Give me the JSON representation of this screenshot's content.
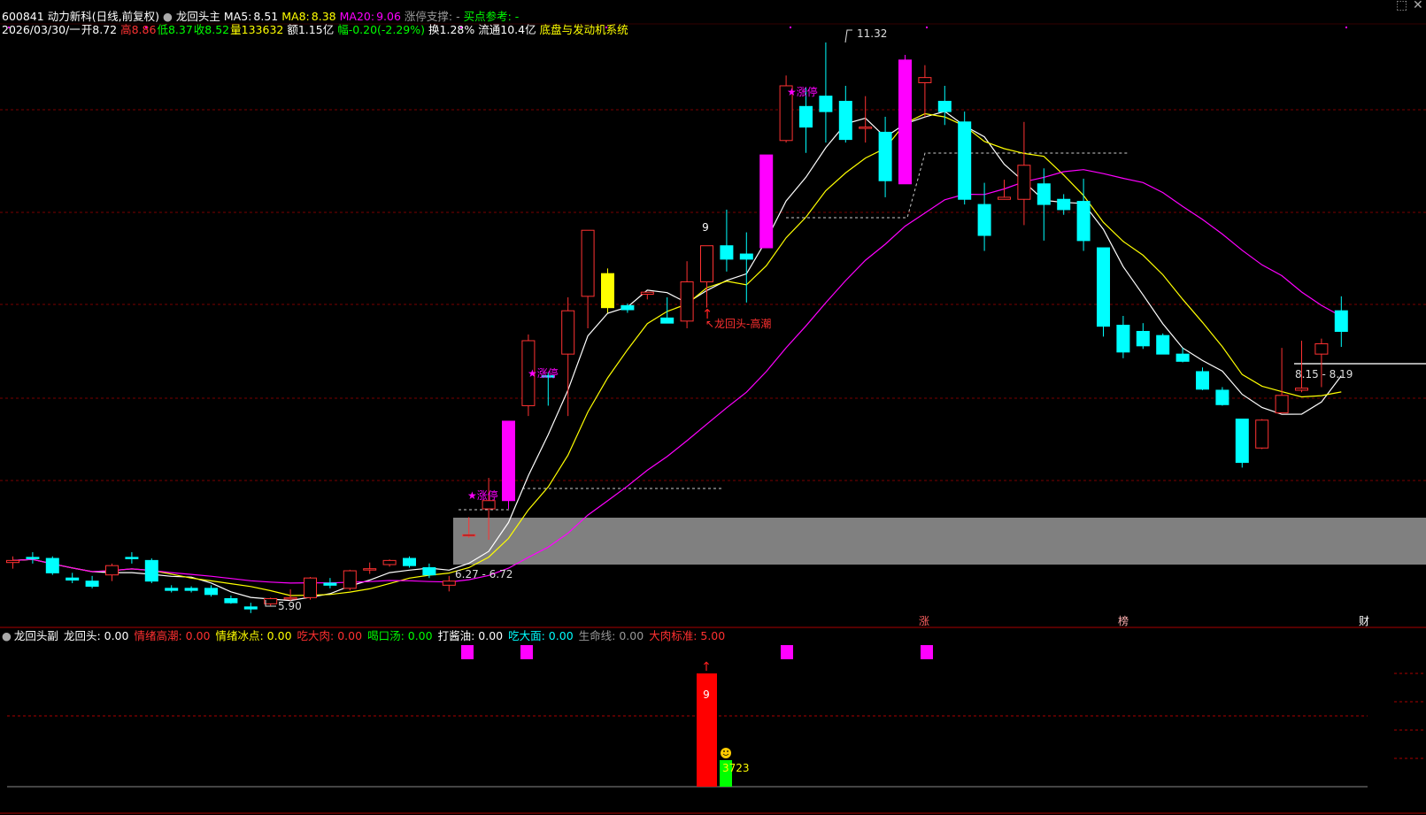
{
  "header": {
    "code": "600841",
    "name": "动力新科(日线,前复权)",
    "indicator_name": "龙回头主",
    "ma5_label": "MA5:",
    "ma5_value": "8.51",
    "ma8_label": "MA8:",
    "ma8_value": "8.38",
    "ma20_label": "MA20:",
    "ma20_value": "9.06",
    "support": "涨停支撑: -",
    "buy_ref": "买点参考: -"
  },
  "quote": {
    "date": "2026/03/30/一",
    "open": "开8.72",
    "high": "高8.86",
    "low": "低8.37",
    "close": "收8.52",
    "volume": "量133632",
    "amount": "额1.15亿",
    "change": "幅-0.20(-2.29%)",
    "turnover": "换1.28%",
    "float_cap": "流通10.4亿",
    "system": "底盘与发动机系统"
  },
  "annotations": {
    "high_price": "11.32",
    "low_price": "5.90",
    "left_range": "6.27 - 6.72",
    "right_range": "8.15 - 8.19",
    "nine": "9",
    "signal": "↖龙回头-高潮",
    "limit_up": "★涨停"
  },
  "bottom_tags": {
    "zhang": "涨",
    "bang": "榜",
    "cai": "财"
  },
  "sub_panel": {
    "title": "龙回头副",
    "items": [
      {
        "label": "龙回头: 0.00",
        "color": "#ffffff"
      },
      {
        "label": "情绪高潮: 0.00",
        "color": "#ff3030"
      },
      {
        "label": "情绪冰点: 0.00",
        "color": "#ffff00"
      },
      {
        "label": "吃大肉: 0.00",
        "color": "#ff3030"
      },
      {
        "label": "喝口汤: 0.00",
        "color": "#00ff00"
      },
      {
        "label": "打酱油: 0.00",
        "color": "#ffffff"
      },
      {
        "label": "吃大面: 0.00",
        "color": "#00ffff"
      },
      {
        "label": "生命线: 0.00",
        "color": "#999999"
      },
      {
        "label": "大肉标准: 5.00",
        "color": "#ff3030"
      }
    ],
    "bar_label": "9",
    "green_label": "3723"
  },
  "colors": {
    "up": "#ff3232",
    "down": "#00ffff",
    "ma5": "#ffffff",
    "ma8": "#ffff00",
    "ma20": "#ff00ff",
    "limit_up_bar": "#ff00ff",
    "special_bar": "#ffff00"
  },
  "chart_data": {
    "type": "candlestick",
    "price_range": [
      5.5,
      11.6
    ],
    "candles": [
      {
        "o": 6.28,
        "h": 6.34,
        "l": 6.22,
        "c": 6.3
      },
      {
        "o": 6.33,
        "h": 6.38,
        "l": 6.27,
        "c": 6.32
      },
      {
        "o": 6.32,
        "h": 6.34,
        "l": 6.16,
        "c": 6.18
      },
      {
        "o": 6.13,
        "h": 6.18,
        "l": 6.08,
        "c": 6.11
      },
      {
        "o": 6.1,
        "h": 6.15,
        "l": 6.03,
        "c": 6.05
      },
      {
        "o": 6.16,
        "h": 6.27,
        "l": 6.1,
        "c": 6.25
      },
      {
        "o": 6.33,
        "h": 6.38,
        "l": 6.27,
        "c": 6.32
      },
      {
        "o": 6.3,
        "h": 6.32,
        "l": 6.08,
        "c": 6.1
      },
      {
        "o": 6.03,
        "h": 6.06,
        "l": 5.99,
        "c": 6.01
      },
      {
        "o": 6.03,
        "h": 6.05,
        "l": 5.99,
        "c": 6.01
      },
      {
        "o": 6.03,
        "h": 6.06,
        "l": 5.95,
        "c": 5.97
      },
      {
        "o": 5.93,
        "h": 5.96,
        "l": 5.88,
        "c": 5.89
      },
      {
        "o": 5.85,
        "h": 5.89,
        "l": 5.79,
        "c": 5.83
      },
      {
        "o": 5.88,
        "h": 5.94,
        "l": 5.86,
        "c": 5.93
      },
      {
        "o": 5.93,
        "h": 6.02,
        "l": 5.91,
        "c": 5.94
      },
      {
        "o": 5.94,
        "h": 6.14,
        "l": 5.92,
        "c": 6.13
      },
      {
        "o": 6.08,
        "h": 6.13,
        "l": 6.03,
        "c": 6.06
      },
      {
        "o": 6.03,
        "h": 6.21,
        "l": 6.01,
        "c": 6.2
      },
      {
        "o": 6.22,
        "h": 6.28,
        "l": 6.17,
        "c": 6.22
      },
      {
        "o": 6.26,
        "h": 6.31,
        "l": 6.24,
        "c": 6.3
      },
      {
        "o": 6.32,
        "h": 6.34,
        "l": 6.23,
        "c": 6.25
      },
      {
        "o": 6.23,
        "h": 6.27,
        "l": 6.13,
        "c": 6.16
      },
      {
        "o": 6.06,
        "h": 6.15,
        "l": 6.0,
        "c": 6.1
      },
      {
        "o": 6.55,
        "h": 6.72,
        "l": 6.52,
        "c": 6.55
      },
      {
        "o": 6.8,
        "h": 7.1,
        "l": 6.5,
        "c": 6.88
      },
      {
        "o": 6.88,
        "h": 7.65,
        "l": 6.8,
        "c": 7.65
      },
      {
        "o": 7.8,
        "h": 8.49,
        "l": 7.7,
        "c": 8.43
      },
      {
        "o": 8.09,
        "h": 8.12,
        "l": 7.8,
        "c": 8.08
      },
      {
        "o": 8.3,
        "h": 8.85,
        "l": 7.7,
        "c": 8.72
      },
      {
        "o": 8.86,
        "h": 9.15,
        "l": 8.55,
        "c": 9.5
      },
      {
        "o": 9.08,
        "h": 9.13,
        "l": 8.7,
        "c": 8.75
      },
      {
        "o": 8.77,
        "h": 8.79,
        "l": 8.7,
        "c": 8.73
      },
      {
        "o": 8.88,
        "h": 8.9,
        "l": 8.83,
        "c": 8.9
      },
      {
        "o": 8.65,
        "h": 8.85,
        "l": 8.6,
        "c": 8.6
      },
      {
        "o": 8.62,
        "h": 9.2,
        "l": 8.55,
        "c": 9.0
      },
      {
        "o": 9.0,
        "h": 9.35,
        "l": 8.75,
        "c": 9.35
      },
      {
        "o": 9.35,
        "h": 9.7,
        "l": 9.1,
        "c": 9.22
      },
      {
        "o": 9.27,
        "h": 9.48,
        "l": 8.8,
        "c": 9.22
      },
      {
        "o": 9.33,
        "h": 10.23,
        "l": 9.33,
        "c": 10.23
      },
      {
        "o": 10.37,
        "h": 11.0,
        "l": 10.35,
        "c": 10.9
      },
      {
        "o": 10.7,
        "h": 10.88,
        "l": 10.25,
        "c": 10.5
      },
      {
        "o": 10.8,
        "h": 11.32,
        "l": 10.35,
        "c": 10.65
      },
      {
        "o": 10.75,
        "h": 10.9,
        "l": 10.35,
        "c": 10.38
      },
      {
        "o": 10.5,
        "h": 10.8,
        "l": 10.35,
        "c": 10.5
      },
      {
        "o": 10.45,
        "h": 10.6,
        "l": 9.82,
        "c": 9.98
      },
      {
        "o": 9.95,
        "h": 11.2,
        "l": 9.95,
        "c": 11.15
      },
      {
        "o": 10.93,
        "h": 11.1,
        "l": 10.6,
        "c": 10.98
      },
      {
        "o": 10.75,
        "h": 10.9,
        "l": 10.52,
        "c": 10.65
      },
      {
        "o": 10.55,
        "h": 10.65,
        "l": 9.75,
        "c": 9.8
      },
      {
        "o": 9.75,
        "h": 9.96,
        "l": 9.3,
        "c": 9.45
      },
      {
        "o": 9.8,
        "h": 9.99,
        "l": 9.8,
        "c": 9.82
      },
      {
        "o": 9.8,
        "h": 10.55,
        "l": 9.55,
        "c": 10.13
      },
      {
        "o": 9.95,
        "h": 10.1,
        "l": 9.4,
        "c": 9.75
      },
      {
        "o": 9.8,
        "h": 9.85,
        "l": 9.65,
        "c": 9.7
      },
      {
        "o": 9.78,
        "h": 10.0,
        "l": 9.3,
        "c": 9.4
      },
      {
        "o": 9.33,
        "h": 9.33,
        "l": 8.47,
        "c": 8.57
      },
      {
        "o": 8.58,
        "h": 8.67,
        "l": 8.26,
        "c": 8.32
      },
      {
        "o": 8.52,
        "h": 8.6,
        "l": 8.35,
        "c": 8.38
      },
      {
        "o": 8.48,
        "h": 8.5,
        "l": 8.3,
        "c": 8.3
      },
      {
        "o": 8.3,
        "h": 8.36,
        "l": 8.22,
        "c": 8.23
      },
      {
        "o": 8.13,
        "h": 8.17,
        "l": 7.95,
        "c": 7.96
      },
      {
        "o": 7.95,
        "h": 7.98,
        "l": 7.8,
        "c": 7.81
      },
      {
        "o": 7.67,
        "h": 7.67,
        "l": 7.2,
        "c": 7.25
      },
      {
        "o": 7.39,
        "h": 7.67,
        "l": 7.38,
        "c": 7.66
      },
      {
        "o": 7.73,
        "h": 8.36,
        "l": 7.73,
        "c": 7.9
      },
      {
        "o": 7.95,
        "h": 8.43,
        "l": 7.93,
        "c": 7.97
      },
      {
        "o": 8.3,
        "h": 8.45,
        "l": 7.98,
        "c": 8.4
      },
      {
        "o": 8.72,
        "h": 8.86,
        "l": 8.37,
        "c": 8.52
      }
    ],
    "limit_up_days": [
      25,
      38,
      45
    ],
    "special_day": 30
  }
}
